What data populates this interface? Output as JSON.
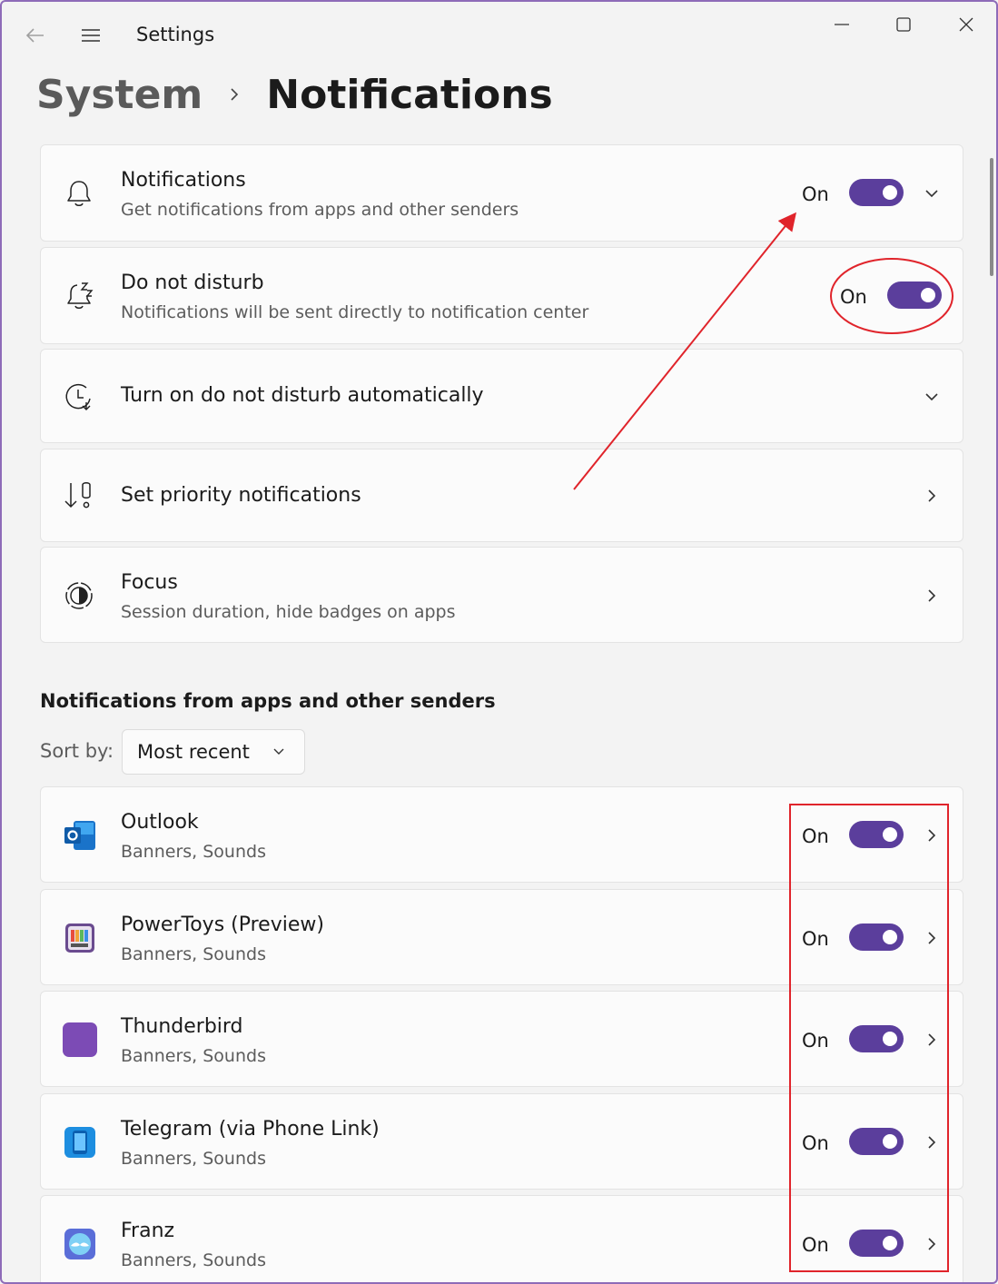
{
  "window": {
    "title": "Settings"
  },
  "breadcrumb": {
    "parent": "System",
    "current": "Notifications"
  },
  "settings": [
    {
      "title": "Notifications",
      "subtitle": "Get notifications from apps and other senders",
      "state": "On",
      "icon": "bell-icon"
    },
    {
      "title": "Do not disturb",
      "subtitle": "Notifications will be sent directly to notification center",
      "state": "On",
      "icon": "snooze-bell-icon"
    },
    {
      "title": "Turn on do not disturb automatically",
      "icon": "clock-icon"
    },
    {
      "title": "Set priority notifications",
      "icon": "priority-icon"
    },
    {
      "title": "Focus",
      "subtitle": "Session duration, hide badges on apps",
      "icon": "focus-icon"
    }
  ],
  "apps_section": {
    "title": "Notifications from apps and other senders",
    "sort_label": "Sort by:",
    "sort_value": "Most recent"
  },
  "apps": [
    {
      "name": "Outlook",
      "detail": "Banners, Sounds",
      "state": "On",
      "icon": "outlook-icon"
    },
    {
      "name": "PowerToys (Preview)",
      "detail": "Banners, Sounds",
      "state": "On",
      "icon": "powertoys-icon"
    },
    {
      "name": "Thunderbird",
      "detail": "Banners, Sounds",
      "state": "On",
      "icon": "thunderbird-icon"
    },
    {
      "name": "Telegram (via Phone Link)",
      "detail": "Banners, Sounds",
      "state": "On",
      "icon": "telegram-icon"
    },
    {
      "name": "Franz",
      "detail": "Banners, Sounds",
      "state": "On",
      "icon": "franz-icon"
    }
  ],
  "colors": {
    "accent": "#5b3e9c",
    "annotation": "#e0242b"
  }
}
